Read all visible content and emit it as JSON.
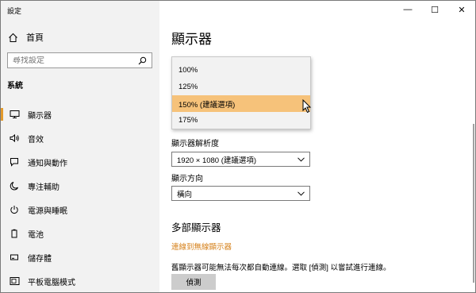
{
  "window": {
    "title": "設定",
    "controls": {
      "minimize": "—",
      "maximize": "☐",
      "close": "✕"
    }
  },
  "sidebar": {
    "home_label": "首頁",
    "search_placeholder": "尋找設定",
    "section_title": "系統",
    "items": [
      {
        "label": "顯示器",
        "icon": "monitor-icon"
      },
      {
        "label": "音效",
        "icon": "speaker-icon"
      },
      {
        "label": "通知與動作",
        "icon": "notification-icon"
      },
      {
        "label": "專注輔助",
        "icon": "moon-icon"
      },
      {
        "label": "電源與睡眠",
        "icon": "power-icon"
      },
      {
        "label": "電池",
        "icon": "battery-icon"
      },
      {
        "label": "儲存體",
        "icon": "storage-icon"
      },
      {
        "label": "平板電腦模式",
        "icon": "tablet-icon"
      }
    ]
  },
  "main": {
    "title": "顯示器",
    "scale_options": [
      "100%",
      "125%",
      "150% (建議選項)",
      "175%"
    ],
    "scale_selected": "150% (建議選項)",
    "resolution_label": "顯示器解析度",
    "resolution_value": "1920 × 1080 (建議選項)",
    "orientation_label": "顯示方向",
    "orientation_value": "橫向",
    "multi_heading": "多部顯示器",
    "wireless_link": "連線到無線顯示器",
    "detect_note": "舊顯示器可能無法每次都自動連線。選取 [偵測] 以嘗試進行連線。",
    "detect_button": "偵測"
  },
  "colors": {
    "accent": "#e39a2b",
    "selected_option": "#f6c27a",
    "link": "#d6821c",
    "sidebar_bg": "#f2f2f2"
  }
}
